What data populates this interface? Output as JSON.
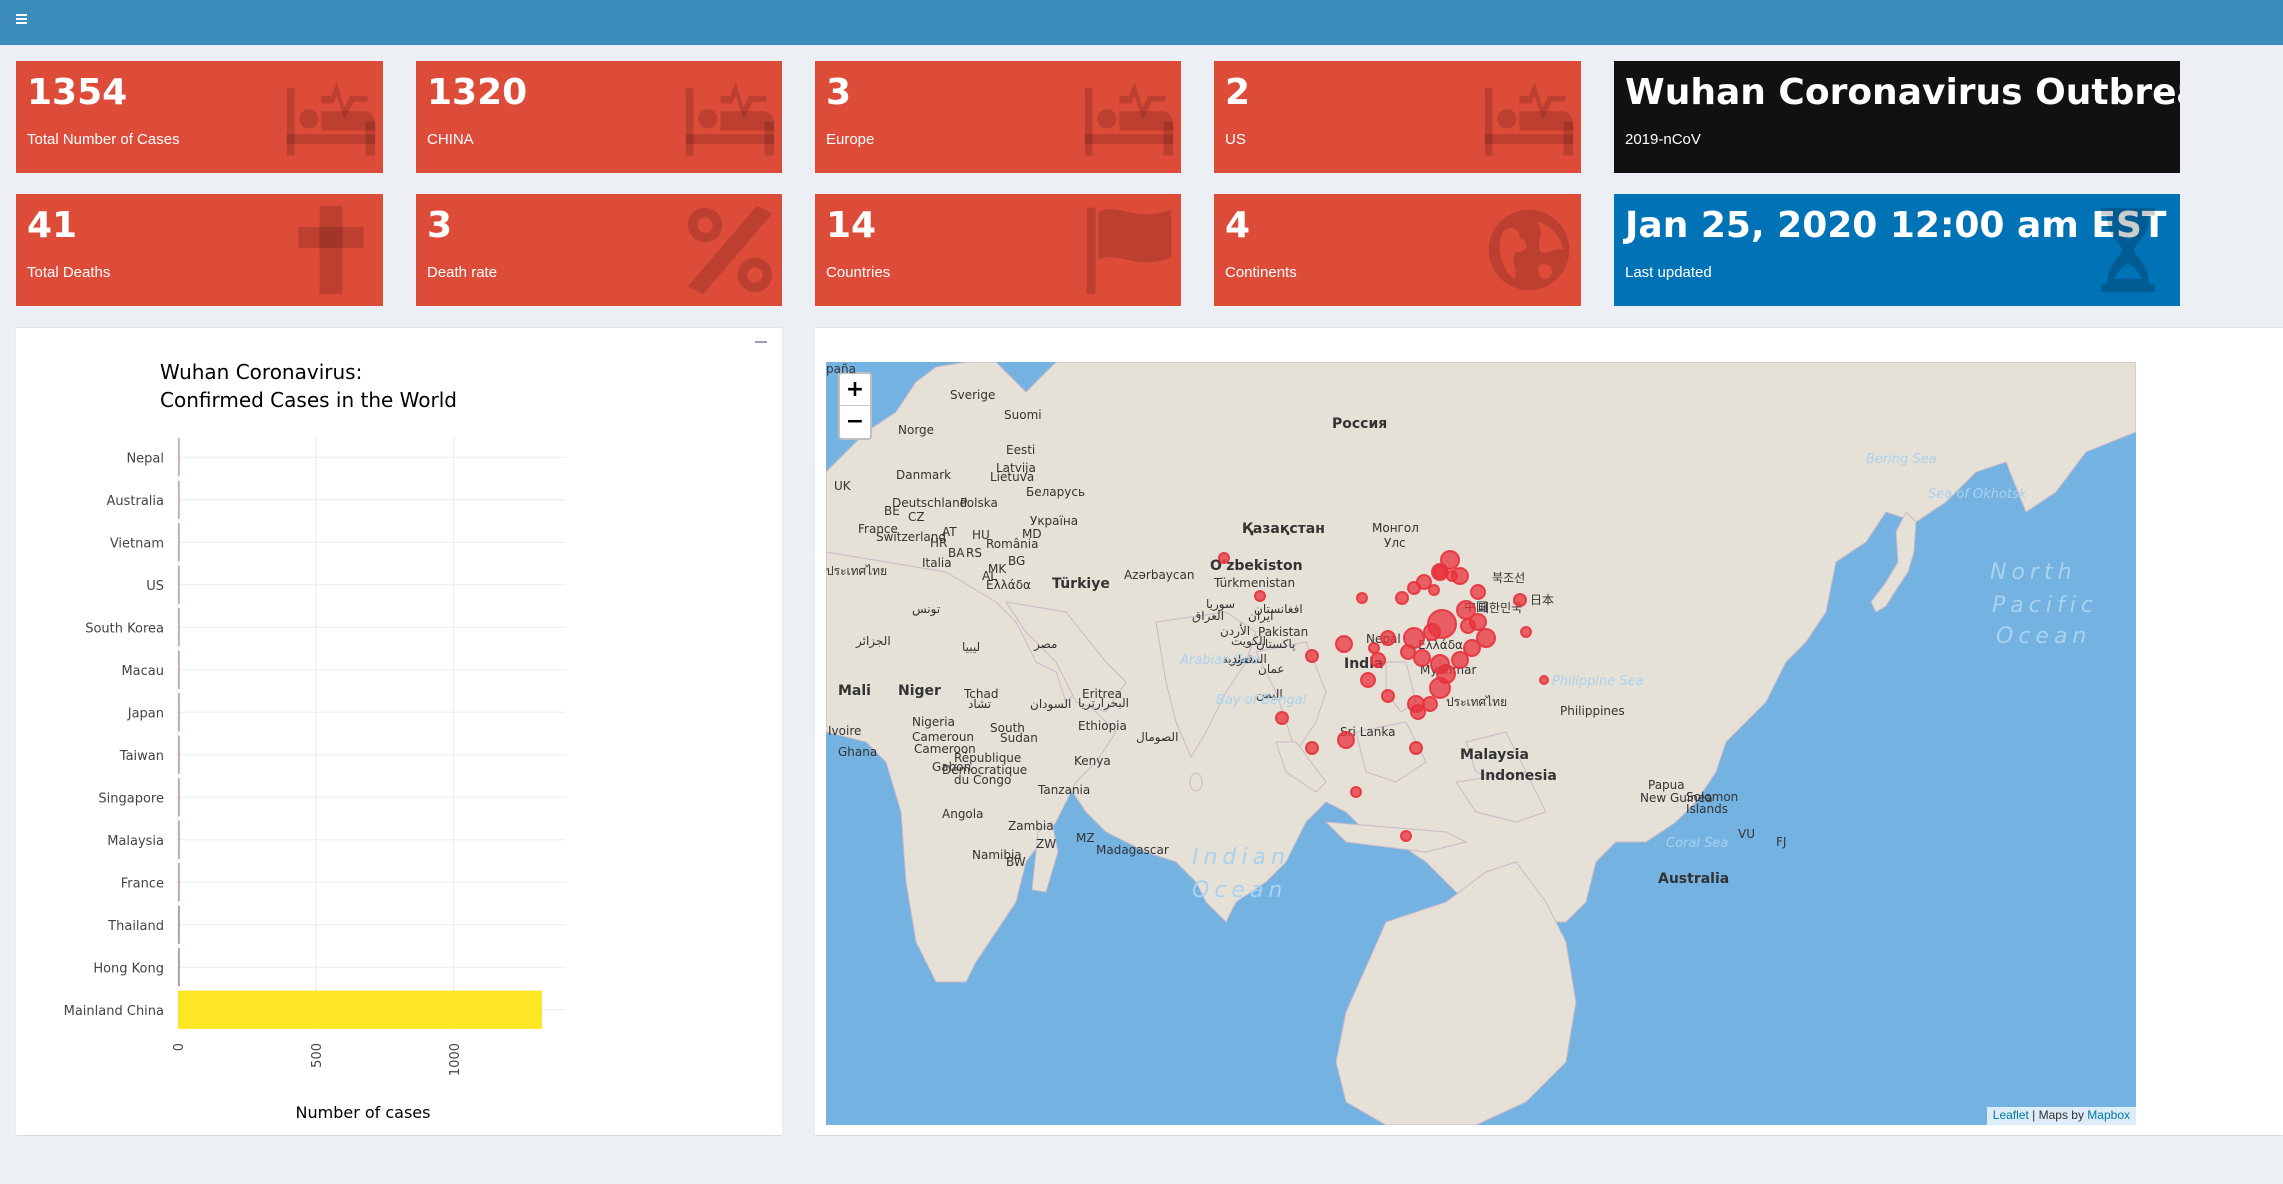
{
  "value_boxes": [
    {
      "value": "1354",
      "label": "Total Number of Cases",
      "icon": "bed-pulse-icon"
    },
    {
      "value": "1320",
      "label": "CHINA",
      "icon": "bed-pulse-icon"
    },
    {
      "value": "3",
      "label": "Europe",
      "icon": "bed-pulse-icon"
    },
    {
      "value": "2",
      "label": "US",
      "icon": "bed-pulse-icon"
    },
    {
      "value": "Wuhan Coronavirus Outbreak",
      "label": "2019-nCoV",
      "color": "#111111"
    },
    {
      "value": "41",
      "label": "Total Deaths",
      "icon": "cross-icon"
    },
    {
      "value": "3",
      "label": "Death rate",
      "icon": "percent-icon"
    },
    {
      "value": "14",
      "label": "Countries",
      "icon": "flag-icon"
    },
    {
      "value": "4",
      "label": "Continents",
      "icon": "globe-icon"
    },
    {
      "value": "Jan 25, 2020 12:00 am EST",
      "label": "Last updated",
      "icon": "hourglass-icon",
      "color": "#0073b7"
    }
  ],
  "colors": {
    "header": "#3c8dbc",
    "red": "#dd4b39",
    "black": "#111111",
    "blue": "#0073b7",
    "bar_mainland": "#fde725",
    "bar_small": "#440154",
    "map_water": "#74b2e2",
    "map_land": "#e6e1d7",
    "marker": "#e8323c"
  },
  "chart_data": {
    "type": "bar",
    "orientation": "horizontal",
    "title": "Wuhan Coronavirus:\nConfirmed Cases in the World",
    "title_lines": [
      "Wuhan Coronavirus:",
      "Confirmed Cases in the World"
    ],
    "xlabel": "Number of cases",
    "ylabel": "",
    "categories": [
      "Nepal",
      "Australia",
      "Vietnam",
      "US",
      "South Korea",
      "Macau",
      "Japan",
      "Taiwan",
      "Singapore",
      "Malaysia",
      "France",
      "Thailand",
      "Hong Kong",
      "Mainland China"
    ],
    "values": [
      1,
      1,
      2,
      2,
      2,
      2,
      3,
      3,
      3,
      3,
      3,
      5,
      5,
      1320
    ],
    "xlim": [
      0,
      1400
    ],
    "xticks": [
      0,
      500,
      1000
    ],
    "xtick_labels": [
      "0",
      "500",
      "1000"
    ],
    "grid": true,
    "legend": "none"
  },
  "map": {
    "zoom_in": "+",
    "zoom_out": "−",
    "attribution_leaflet": "Leaflet",
    "attribution_sep": " | Maps by ",
    "attribution_mapbox": "Mapbox",
    "labels": [
      {
        "text": "Sverige"
      },
      {
        "text": "Suomi"
      },
      {
        "text": "Norge"
      },
      {
        "text": "Eesti"
      },
      {
        "text": "Latvija"
      },
      {
        "text": "Lietuva"
      },
      {
        "text": "Danmark"
      },
      {
        "text": "Беларусь"
      },
      {
        "text": "Deutschland"
      },
      {
        "text": "Polska"
      },
      {
        "text": "UK"
      },
      {
        "text": "BE"
      },
      {
        "text": "CZ"
      },
      {
        "text": "Україна"
      },
      {
        "text": "France"
      },
      {
        "text": "Switzerland"
      },
      {
        "text": "AT"
      },
      {
        "text": "HU"
      },
      {
        "text": "MD"
      },
      {
        "text": "România"
      },
      {
        "text": "HR"
      },
      {
        "text": "BA"
      },
      {
        "text": "RS"
      },
      {
        "text": "Italia"
      },
      {
        "text": "BG"
      },
      {
        "text": "MK"
      },
      {
        "text": "AL"
      },
      {
        "text": "Ελλάδα"
      },
      {
        "text": "Türkiye"
      },
      {
        "text": "Azərbaycan"
      },
      {
        "text": "Россия"
      },
      {
        "text": "Қазақстан"
      },
      {
        "text": "Монгол"
      },
      {
        "text": "Улс"
      },
      {
        "text": "O'zbekiston"
      },
      {
        "text": "Türkmenistan"
      },
      {
        "text": "افغانستان"
      },
      {
        "text": "Pakistan"
      },
      {
        "text": "پاکستان"
      },
      {
        "text": "ایران"
      },
      {
        "text": "العراق"
      },
      {
        "text": "سوريا"
      },
      {
        "text": "الأردن"
      },
      {
        "text": "الكويت"
      },
      {
        "text": "السعودية"
      },
      {
        "text": "عمان"
      },
      {
        "text": "قطر"
      },
      {
        "text": "اليمن"
      },
      {
        "text": "مصر"
      },
      {
        "text": "ليبيا"
      },
      {
        "text": "تونس"
      },
      {
        "text": "الجزائر"
      },
      {
        "text": "India"
      },
      {
        "text": "Nepal"
      },
      {
        "text": "Myanmar"
      },
      {
        "text": "ประเทศไทย"
      },
      {
        "text": "Sri Lanka"
      },
      {
        "text": "中国"
      },
      {
        "text": "대한민국"
      },
      {
        "text": "북조선"
      },
      {
        "text": "日本"
      },
      {
        "text": "Philippines"
      },
      {
        "text": "Malaysia"
      },
      {
        "text": "Indonesia"
      },
      {
        "text": "Papua"
      },
      {
        "text": "New Guinea"
      },
      {
        "text": "Solomon"
      },
      {
        "text": "Islands"
      },
      {
        "text": "VU"
      },
      {
        "text": "FJ"
      },
      {
        "text": "Australia"
      },
      {
        "text": "Mali"
      },
      {
        "text": "Niger"
      },
      {
        "text": "Tchad"
      },
      {
        "text": "تشاد"
      },
      {
        "text": "السودان"
      },
      {
        "text": "Eritrea"
      },
      {
        "text": "ارتريا"
      },
      {
        "text": "Ethiopia"
      },
      {
        "text": "South"
      },
      {
        "text": "Sudan"
      },
      {
        "text": "Nigeria"
      },
      {
        "text": "Cameroun"
      },
      {
        "text": "Cameroon"
      },
      {
        "text": "Ivoire"
      },
      {
        "text": "Ghana"
      },
      {
        "text": "Gabon"
      },
      {
        "text": "République"
      },
      {
        "text": "Démocratique"
      },
      {
        "text": "du Congo"
      },
      {
        "text": "Kenya"
      },
      {
        "text": "Tanzania"
      },
      {
        "text": "Angola"
      },
      {
        "text": "Zambia"
      },
      {
        "text": "ZW"
      },
      {
        "text": "MZ"
      },
      {
        "text": "Namibia"
      },
      {
        "text": "BW"
      },
      {
        "text": "Madagascar"
      },
      {
        "text": "الصومال"
      },
      {
        "text": "البحر"
      },
      {
        "text": "Arabian Sea"
      },
      {
        "text": "Bay of Bengal"
      },
      {
        "text": "Philippine Sea"
      },
      {
        "text": "Coral Sea"
      },
      {
        "text": "Bering Sea"
      },
      {
        "text": "Sea of Okhotsk"
      },
      {
        "text": "North"
      },
      {
        "text": "Pacific"
      },
      {
        "text": "Ocean"
      },
      {
        "text": "Indian"
      },
      {
        "text": "Ocean"
      },
      {
        "text": "Ελλάδα"
      },
      {
        "text": "ประเทศไทย"
      },
      {
        "text": "paña"
      }
    ],
    "markers_count": 40
  }
}
